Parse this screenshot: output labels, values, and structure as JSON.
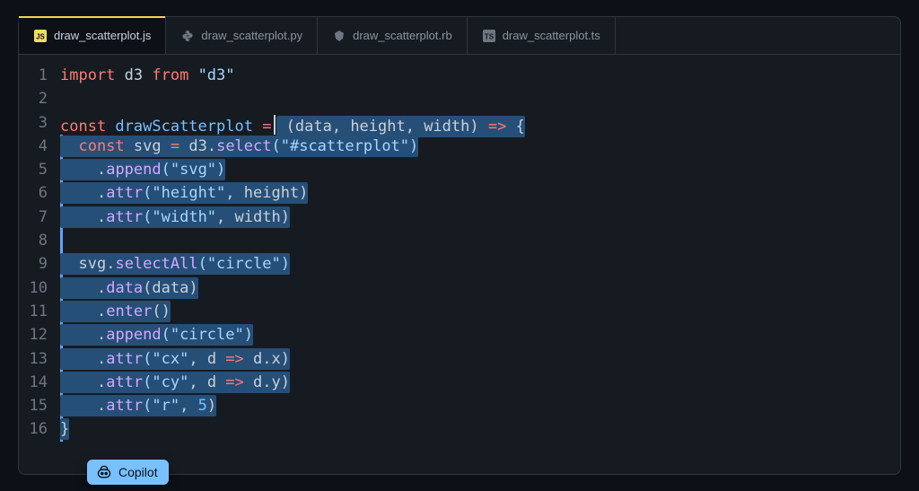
{
  "tabs": [
    {
      "icon": "js",
      "label": "draw_scatterplot.js",
      "active": true
    },
    {
      "icon": "py",
      "label": "draw_scatterplot.py",
      "active": false
    },
    {
      "icon": "rb",
      "label": "draw_scatterplot.rb",
      "active": false
    },
    {
      "icon": "ts",
      "label": "draw_scatterplot.ts",
      "active": false
    }
  ],
  "line_numbers": [
    "1",
    "2",
    "3",
    "4",
    "5",
    "6",
    "7",
    "8",
    "9",
    "10",
    "11",
    "12",
    "13",
    "14",
    "15",
    "16"
  ],
  "code": {
    "l1_import": "import",
    "l1_d3": " d3 ",
    "l1_from": "from",
    "l1_str": " \"d3\"",
    "l3_const": "const",
    "l3_name": " drawScatterplot ",
    "l3_eq": "=",
    "l3_args": " (data, height, width) ",
    "l3_arrow": "=>",
    "l3_brace": " {",
    "l4_indent": "  ",
    "l4_const": "const",
    "l4_svg": " svg ",
    "l4_eq": "=",
    "l4_d3": " d3",
    "l4_dot": ".",
    "l4_select": "select",
    "l4_arg": "(\"#scatterplot\")",
    "l5_indent": "    ",
    "l5_dot": ".",
    "l5_append": "append",
    "l5_arg": "(\"svg\")",
    "l6_indent": "    ",
    "l6_dot": ".",
    "l6_attr": "attr",
    "l6_arg_s": "(\"height\"",
    "l6_arg_c": ", height)",
    "l7_indent": "    ",
    "l7_dot": ".",
    "l7_attr": "attr",
    "l7_arg_s": "(\"width\"",
    "l7_arg_c": ", width)",
    "l9_indent": "  ",
    "l9_svg": "svg",
    "l9_dot": ".",
    "l9_selectAll": "selectAll",
    "l9_arg": "(\"circle\")",
    "l10_indent": "    ",
    "l10_dot": ".",
    "l10_data": "data",
    "l10_arg": "(data)",
    "l11_indent": "    ",
    "l11_dot": ".",
    "l11_enter": "enter",
    "l11_arg": "()",
    "l12_indent": "    ",
    "l12_dot": ".",
    "l12_append": "append",
    "l12_arg": "(\"circle\")",
    "l13_indent": "    ",
    "l13_dot": ".",
    "l13_attr": "attr",
    "l13_arg_s": "(\"cx\"",
    "l13_arg_c": ", d ",
    "l13_arrow": "=>",
    "l13_tail": " d.x)",
    "l14_indent": "    ",
    "l14_dot": ".",
    "l14_attr": "attr",
    "l14_arg_s": "(\"cy\"",
    "l14_arg_c": ", d ",
    "l14_arrow": "=>",
    "l14_tail": " d.y)",
    "l15_indent": "    ",
    "l15_dot": ".",
    "l15_attr": "attr",
    "l15_arg_s": "(\"r\"",
    "l15_arg_c": ", ",
    "l15_num": "5",
    "l15_close": ")",
    "l16_brace": "}"
  },
  "copilot_label": "Copilot"
}
